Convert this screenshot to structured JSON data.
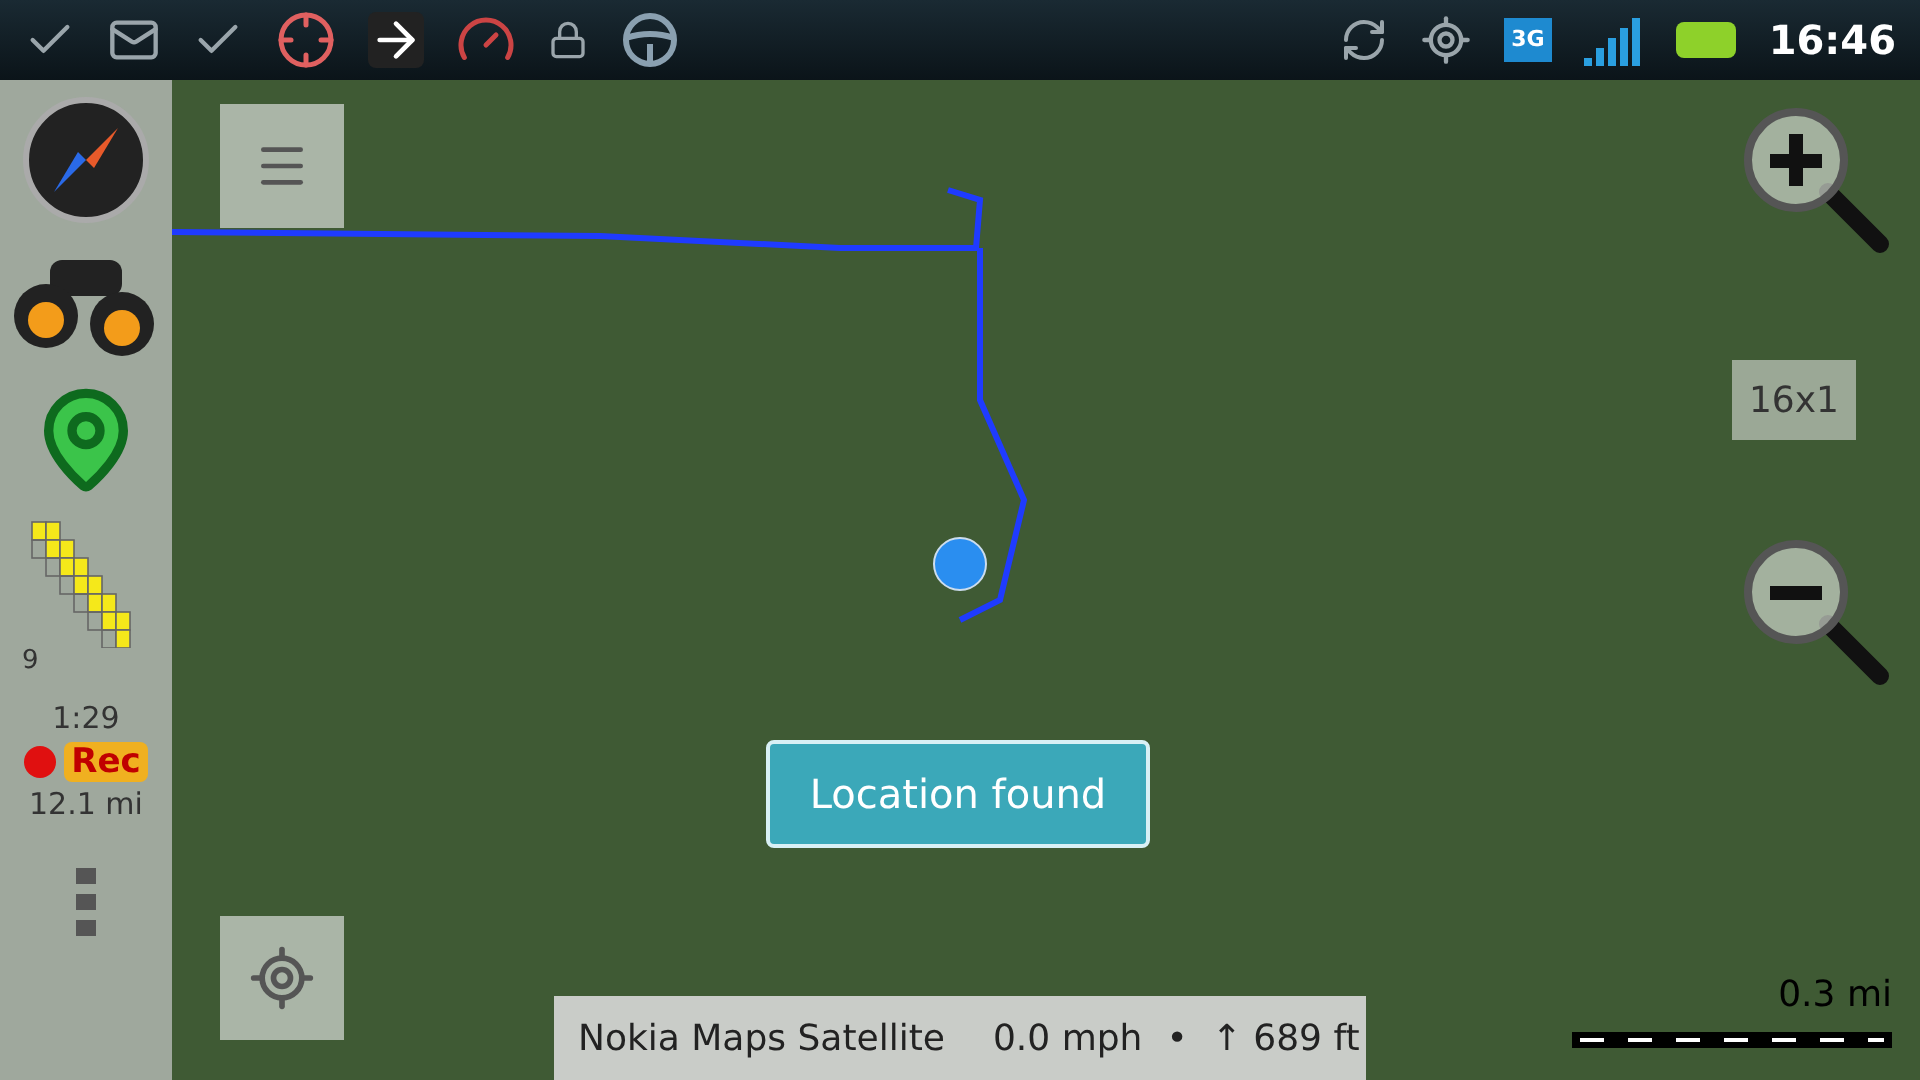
{
  "status_bar": {
    "network": "3G",
    "time": "16:46"
  },
  "sidebar": {
    "satellites": "9",
    "duration": "1:29",
    "recording": true,
    "rec_label": "Rec",
    "distance": "12.1 mi"
  },
  "map": {
    "zoom_label": "16x1",
    "toast": "Location found",
    "scale": "0.3 mi"
  },
  "info_bar": {
    "source": "Nokia Maps Satellite",
    "speed": "0.0 mph",
    "separator": "•",
    "altitude": "↑ 689 ft"
  }
}
